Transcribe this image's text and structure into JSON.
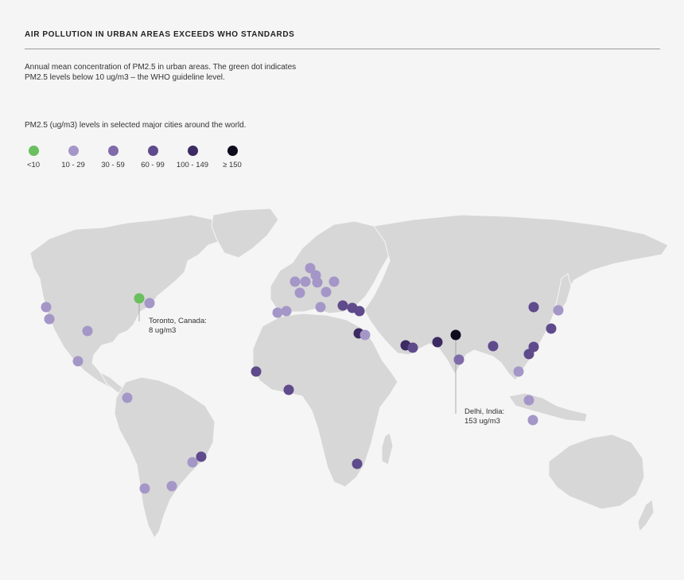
{
  "title": "AIR POLLUTION IN URBAN AREAS EXCEEDS WHO STANDARDS",
  "description": {
    "line1": "Annual mean concentration of PM2.5 in urban areas. The green dot indicates",
    "line2": "PM2.5 levels below 10 ug/m3 – the WHO guideline level."
  },
  "legend": {
    "title": "PM2.5 (ug/m3) levels in selected major cities around the world.",
    "items": [
      {
        "label": "<10",
        "color": "#6abf5e",
        "level": 0
      },
      {
        "label": "10 - 29",
        "color": "#a596c8",
        "level": 1
      },
      {
        "label": "30 - 59",
        "color": "#7f6aaa",
        "level": 2
      },
      {
        "label": "60 - 99",
        "color": "#5f4a8c",
        "level": 3
      },
      {
        "label": "100 - 149",
        "color": "#3c2a63",
        "level": 4
      },
      {
        "label": "≥ 150",
        "color": "#0e0b1e",
        "level": 5
      }
    ]
  },
  "annotations": {
    "toronto": {
      "line1": "Toronto, Canada:",
      "line2": "8 ug/m3"
    },
    "delhi": {
      "line1": "Delhi, India:",
      "line2": "153 ug/m3"
    }
  },
  "map_colors": {
    "land": "#d7d7d7",
    "background": "#f5f5f5"
  }
}
